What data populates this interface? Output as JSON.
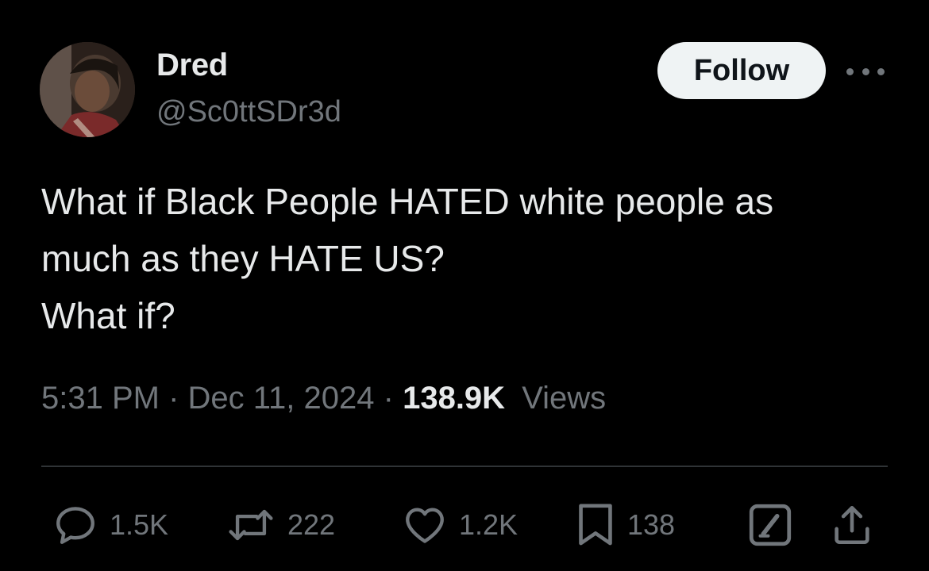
{
  "author": {
    "display_name": "Dred",
    "handle": "@Sc0ttSDr3d"
  },
  "follow_button": {
    "label": "Follow"
  },
  "tweet": {
    "lines": [
      "What if Black People HATED white people as",
      "much as they HATE US?",
      "What if?"
    ]
  },
  "meta": {
    "time": "5:31 PM",
    "separator": "·",
    "date": "Dec 11, 2024",
    "views_count": "138.9K",
    "views_label": "Views"
  },
  "actions": {
    "replies": "1.5K",
    "reposts": "222",
    "likes": "1.2K",
    "bookmarks": "138"
  },
  "icons": {
    "reply": "reply-icon",
    "repost": "repost-icon",
    "like": "heart-icon",
    "bookmark": "bookmark-icon",
    "grok": "grok-icon",
    "share": "share-icon",
    "more": "more-icon"
  },
  "colors": {
    "background": "#000000",
    "primary_text": "#e7e9ea",
    "secondary_text": "#71767b",
    "follow_bg": "#eff3f4",
    "divider": "#2f3336"
  }
}
